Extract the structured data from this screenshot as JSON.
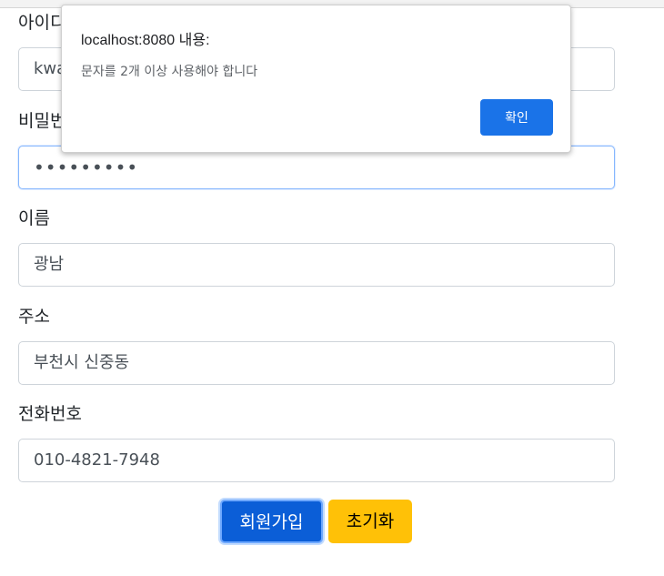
{
  "form": {
    "id_label": "아이디",
    "id_value": "kwa",
    "password_label": "비밀번호",
    "password_value": "•••••••••",
    "name_label": "이름",
    "name_value": "광남",
    "address_label": "주소",
    "address_value": "부천시 신중동",
    "phone_label": "전화번호",
    "phone_value": "010-4821-7948"
  },
  "buttons": {
    "signup_label": "회원가입",
    "reset_label": "초기화"
  },
  "dialog": {
    "title": "localhost:8080 내용:",
    "message": "문자를 2개 이상 사용해야 합니다",
    "ok_label": "확인"
  }
}
